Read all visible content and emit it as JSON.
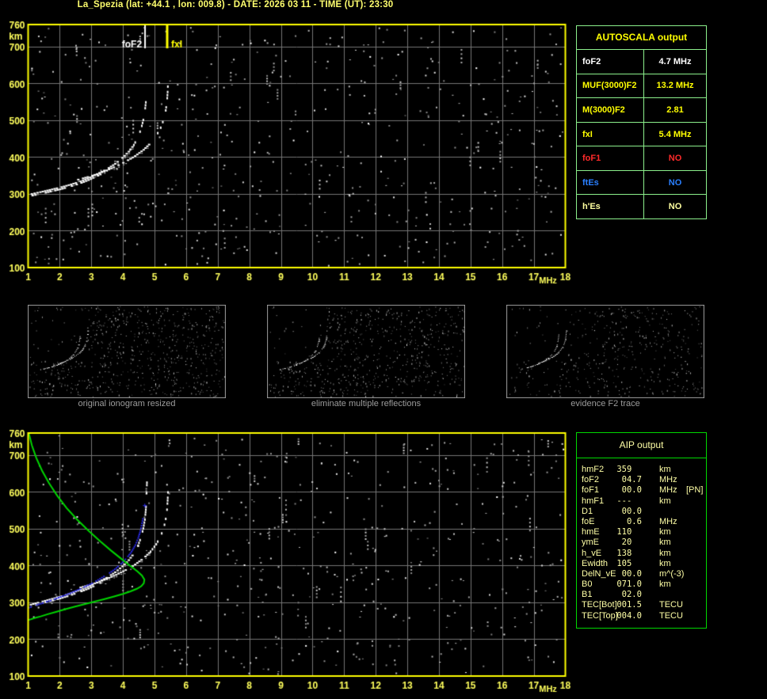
{
  "header": {
    "title": "La_Spezia (lat: +44.1 , lon: 009.8) - DATE: 2026 03 11 - TIME (UT): 23:30",
    "color": "#FFFF6E"
  },
  "autoscala_table": {
    "title": "AUTOSCALA output",
    "title_color": "#FFFF00",
    "border_color": "#8CF08C",
    "rows": [
      {
        "label": "foF2",
        "value": "4.7 MHz",
        "color": "#FFFFFF"
      },
      {
        "label": "MUF(3000)F2",
        "value": "13.2 MHz",
        "color": "#FFFF00"
      },
      {
        "label": "M(3000)F2",
        "value": "2.81",
        "color": "#FFFF00"
      },
      {
        "label": "fxI",
        "value": "5.4 MHz",
        "color": "#FFFF00"
      },
      {
        "label": "foF1",
        "value": "NO",
        "color": "#FF2A2A"
      },
      {
        "label": "ftEs",
        "value": "NO",
        "color": "#2A7FFF"
      },
      {
        "label": "h'Es",
        "value": "NO",
        "color": "#FFFFA0"
      }
    ]
  },
  "thumbnails": [
    {
      "caption": "original ionogram resized"
    },
    {
      "caption": "eliminate multiple reflections"
    },
    {
      "caption": "evidence F2 trace"
    }
  ],
  "aip_table": {
    "title": "AIP output",
    "text_color": "#FFFFA6",
    "border_color": "#00D800",
    "rows": [
      {
        "param": "hmF2",
        "value": "359",
        "unit": "km",
        "note": ""
      },
      {
        "param": "foF2",
        "value": "04.7",
        "unit": "MHz",
        "note": ""
      },
      {
        "param": "foF1",
        "value": "00.0",
        "unit": "MHz",
        "note": "[PN]"
      },
      {
        "param": "hmF1",
        "value": "---",
        "unit": "km",
        "note": ""
      },
      {
        "param": "D1",
        "value": "00.0",
        "unit": "",
        "note": ""
      },
      {
        "param": "foE",
        "value": "0.6",
        "unit": "MHz",
        "note": ""
      },
      {
        "param": "hmE",
        "value": "110",
        "unit": "km",
        "note": ""
      },
      {
        "param": "ymE",
        "value": "20",
        "unit": "km",
        "note": ""
      },
      {
        "param": "h_vE",
        "value": "138",
        "unit": "km",
        "note": ""
      },
      {
        "param": "Ewidth",
        "value": "105",
        "unit": "km",
        "note": ""
      },
      {
        "param": "DelN_vE",
        "value": "00.0",
        "unit": "m^(-3)",
        "note": ""
      },
      {
        "param": "B0",
        "value": "071.0",
        "unit": "km",
        "note": ""
      },
      {
        "param": "B1",
        "value": "02.0",
        "unit": "",
        "note": ""
      },
      {
        "param": "TEC[Bot]",
        "value": "001.5",
        "unit": "TECU",
        "note": ""
      },
      {
        "param": "TEC[Top]",
        "value": "004.0",
        "unit": "TECU",
        "note": ""
      }
    ]
  },
  "chart_data": [
    {
      "id": "ionogram_top",
      "type": "scatter",
      "title": "",
      "xlabel": "MHz",
      "ylabel": "km",
      "xlim": [
        1,
        18
      ],
      "ylim": [
        100,
        760
      ],
      "xticks": [
        1,
        2,
        3,
        4,
        5,
        6,
        7,
        8,
        9,
        10,
        11,
        12,
        13,
        14,
        15,
        16,
        17,
        18
      ],
      "yticks": [
        100,
        200,
        300,
        400,
        500,
        600,
        700,
        760
      ],
      "grid": true,
      "grid_color": "#757575",
      "axis_color": "#FFFF5C",
      "border_color": "#FFFF00",
      "series": [
        {
          "name": "O-mode echo trace",
          "color": "#FFFFFF",
          "style": "speckle",
          "thick_below_km": 360,
          "dash_above_km": 430,
          "points": [
            [
              1.08,
              302
            ],
            [
              1.35,
              307
            ],
            [
              1.65,
              313
            ],
            [
              1.95,
              319
            ],
            [
              2.25,
              326
            ],
            [
              2.55,
              334
            ],
            [
              2.85,
              344
            ],
            [
              3.15,
              356
            ],
            [
              3.45,
              369
            ],
            [
              3.72,
              384
            ],
            [
              3.95,
              400
            ],
            [
              4.15,
              417
            ],
            [
              4.32,
              436
            ],
            [
              4.45,
              457
            ],
            [
              4.55,
              480
            ],
            [
              4.62,
              504
            ],
            [
              4.67,
              528
            ],
            [
              4.7,
              552
            ],
            [
              4.71,
              570
            ]
          ]
        },
        {
          "name": "X-mode echo trace",
          "color": "#FFFFFF",
          "style": "speckle",
          "thick_below_km": 0,
          "dash_above_km": 440,
          "points": [
            [
              2.55,
              341
            ],
            [
              2.85,
              348
            ],
            [
              3.15,
              356
            ],
            [
              3.45,
              366
            ],
            [
              3.75,
              377
            ],
            [
              4.05,
              390
            ],
            [
              4.35,
              405
            ],
            [
              4.62,
              422
            ],
            [
              4.85,
              441
            ],
            [
              5.03,
              461
            ],
            [
              5.17,
              483
            ],
            [
              5.27,
              506
            ],
            [
              5.33,
              530
            ],
            [
              5.37,
              555
            ],
            [
              5.39,
              580
            ],
            [
              5.4,
              602
            ],
            [
              5.41,
              622
            ]
          ]
        }
      ],
      "markers": [
        {
          "label": "foF2",
          "x_mhz": 4.7,
          "color": "#FFFFFF",
          "label_side": "left"
        },
        {
          "label": "fxI",
          "x_mhz": 5.4,
          "color": "#FFFF00",
          "label_side": "right"
        }
      ]
    },
    {
      "id": "ionogram_bottom",
      "type": "scatter",
      "title": "",
      "xlabel": "MHz",
      "ylabel": "km",
      "xlim": [
        1,
        18
      ],
      "ylim": [
        100,
        760
      ],
      "xticks": [
        1,
        2,
        3,
        4,
        5,
        6,
        7,
        8,
        9,
        10,
        11,
        12,
        13,
        14,
        15,
        16,
        17,
        18
      ],
      "yticks": [
        100,
        200,
        300,
        400,
        500,
        600,
        700,
        760
      ],
      "grid": true,
      "grid_color": "#757575",
      "axis_color": "#FFFF5C",
      "border_color": "#FFFF00",
      "series": [
        {
          "name": "O-mode echo trace",
          "color": "#FFFFFF",
          "style": "speckle",
          "thick_below_km": 360,
          "dash_above_km": 430,
          "points": [
            [
              1.05,
              296
            ],
            [
              1.35,
              303
            ],
            [
              1.65,
              310
            ],
            [
              1.95,
              317
            ],
            [
              2.25,
              325
            ],
            [
              2.55,
              334
            ],
            [
              2.85,
              344
            ],
            [
              3.15,
              356
            ],
            [
              3.45,
              369
            ],
            [
              3.72,
              384
            ],
            [
              3.95,
              400
            ],
            [
              4.15,
              417
            ],
            [
              4.32,
              436
            ],
            [
              4.45,
              457
            ],
            [
              4.55,
              480
            ],
            [
              4.62,
              504
            ],
            [
              4.67,
              528
            ],
            [
              4.7,
              555
            ],
            [
              4.72,
              585
            ],
            [
              4.73,
              615
            ],
            [
              4.74,
              642
            ]
          ]
        },
        {
          "name": "X-mode echo trace",
          "color": "#FFFFFF",
          "style": "speckle",
          "thick_below_km": 0,
          "dash_above_km": 440,
          "points": [
            [
              2.55,
              341
            ],
            [
              2.85,
              348
            ],
            [
              3.15,
              356
            ],
            [
              3.45,
              366
            ],
            [
              3.75,
              377
            ],
            [
              4.05,
              390
            ],
            [
              4.35,
              405
            ],
            [
              4.62,
              422
            ],
            [
              4.85,
              441
            ],
            [
              5.03,
              461
            ],
            [
              5.17,
              483
            ],
            [
              5.27,
              506
            ],
            [
              5.33,
              530
            ],
            [
              5.37,
              555
            ],
            [
              5.39,
              580
            ],
            [
              5.4,
              602
            ],
            [
              5.41,
              625
            ]
          ]
        },
        {
          "name": "restored O-trace (AIP)",
          "color": "#2A2AE8",
          "style": "dots",
          "points": [
            [
              1.0,
              288
            ],
            [
              1.25,
              295
            ],
            [
              1.5,
              302
            ],
            [
              1.75,
              309
            ],
            [
              2.0,
              317
            ],
            [
              2.25,
              325
            ],
            [
              2.5,
              334
            ],
            [
              2.75,
              344
            ],
            [
              3.0,
              354
            ],
            [
              3.25,
              366
            ],
            [
              3.5,
              379
            ],
            [
              3.72,
              392
            ],
            [
              3.92,
              407
            ],
            [
              4.1,
              423
            ],
            [
              4.25,
              440
            ],
            [
              4.37,
              458
            ],
            [
              4.46,
              477
            ],
            [
              4.53,
              497
            ],
            [
              4.58,
              517
            ],
            [
              4.62,
              535
            ]
          ],
          "isolated_marker": [
            4.68,
            564
          ]
        },
        {
          "name": "electron density profile",
          "color": "#00D400",
          "style": "line",
          "points": [
            [
              1.02,
              760
            ],
            [
              1.12,
              726
            ],
            [
              1.26,
              692
            ],
            [
              1.44,
              658
            ],
            [
              1.66,
              624
            ],
            [
              1.92,
              590
            ],
            [
              2.22,
              556
            ],
            [
              2.56,
              524
            ],
            [
              2.92,
              494
            ],
            [
              3.28,
              466
            ],
            [
              3.62,
              441
            ],
            [
              3.94,
              419
            ],
            [
              4.22,
              400
            ],
            [
              4.45,
              385
            ],
            [
              4.6,
              373
            ],
            [
              4.68,
              362
            ],
            [
              4.66,
              352
            ],
            [
              4.58,
              344
            ],
            [
              4.44,
              337
            ],
            [
              4.24,
              330
            ],
            [
              4.0,
              323
            ],
            [
              3.72,
              316
            ],
            [
              3.42,
              309
            ],
            [
              3.1,
              302
            ],
            [
              2.78,
              295
            ],
            [
              2.46,
              288
            ],
            [
              2.16,
              281
            ],
            [
              1.88,
              274
            ],
            [
              1.62,
              268
            ],
            [
              1.4,
              262
            ],
            [
              1.22,
              258
            ],
            [
              1.08,
              254
            ],
            [
              1.0,
              252
            ]
          ]
        }
      ],
      "markers": []
    },
    {
      "id": "thumbnails_shared",
      "type": "scatter",
      "note_xlim": [
        0,
        18
      ],
      "xlim": [
        0,
        18
      ],
      "ylim": [
        100,
        760
      ]
    }
  ]
}
